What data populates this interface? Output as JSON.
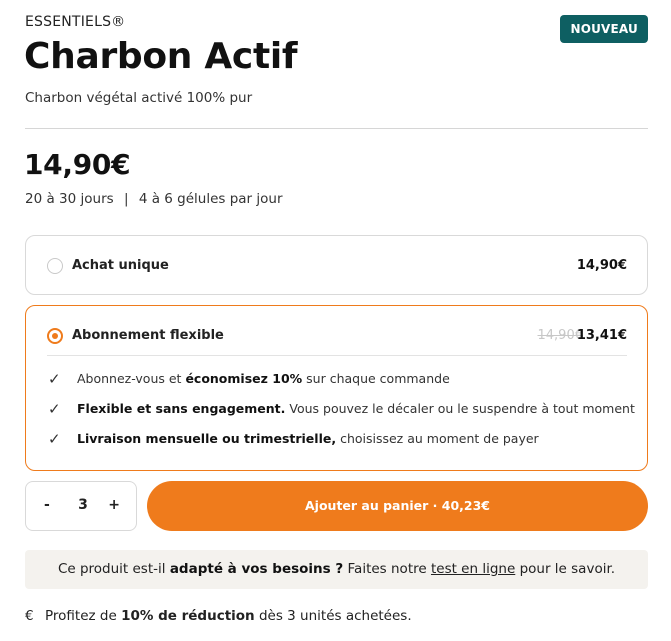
{
  "product": {
    "brand": "ESSENTIELS®",
    "badge": "NOUVEAU",
    "title": "Charbon Actif",
    "subtitle": "Charbon végétal activé 100% pur",
    "price": "14,90€",
    "duration": "20 à 30 jours",
    "separator": "|",
    "dosage": "4 à 6 gélules par jour"
  },
  "options": {
    "one_time": {
      "label": "Achat unique",
      "price": "14,90€"
    },
    "subscription": {
      "label": "Abonnement flexible",
      "old_price": "14,90€",
      "price": "13,41€",
      "benefits": [
        {
          "pre": "Abonnez-vous et ",
          "bold": "économisez 10%",
          "post": " sur chaque commande"
        },
        {
          "pre": "",
          "bold": "Flexible et sans engagement.",
          "post": " Vous pouvez le décaler ou le suspendre à tout moment"
        },
        {
          "pre": "",
          "bold": "Livraison mensuelle ou trimestrielle,",
          "post": " choisissez au moment de payer"
        }
      ]
    }
  },
  "quantity": {
    "minus": "-",
    "value": "3",
    "plus": "+"
  },
  "cart": {
    "label": "Ajouter au panier · 40,23€"
  },
  "info": {
    "pre": "Ce produit est-il ",
    "bold": "adapté à vos besoins ?",
    "mid": " Faites notre ",
    "link": "test en ligne",
    "post": " pour le savoir."
  },
  "promo": {
    "icon": "€",
    "pre": "Profitez de ",
    "bold": "10% de réduction",
    "post": " dès 3 unités achetées."
  },
  "colors": {
    "accent": "#ef7b1c",
    "badge": "#0e5f62",
    "info_bg": "#f4f2ee"
  }
}
